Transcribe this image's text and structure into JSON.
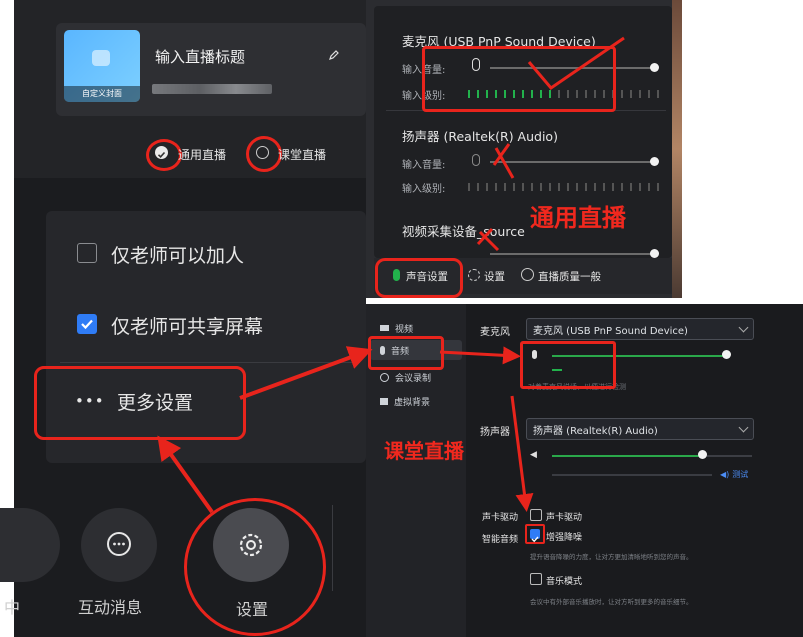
{
  "broadcast_card": {
    "cover_label": "自定义封面",
    "title_placeholder": "输入直播标题",
    "mode_general": "通用直播",
    "mode_class": "课堂直播"
  },
  "settings_menu": {
    "only_teacher_add": "仅老师可以加人",
    "only_teacher_share": "仅老师可共享屏幕",
    "more_settings": "更多设置"
  },
  "bottom_bar": {
    "partial_left": "中",
    "interactive_messages": "互动消息",
    "settings": "设置"
  },
  "audio_panel_general": {
    "mic_title": "麦克风 (USB PnP Sound Device)",
    "input_volume": "输入音量:",
    "input_level": "输入级别:",
    "speaker_title": "扬声器 (Realtek(R) Audio)",
    "video_source": "视频采集设备_source",
    "tab_audio": "声音设置",
    "tab_settings": "设置",
    "tab_quality": "直播质量一般"
  },
  "annotation": {
    "general_live": "通用直播",
    "class_live": "课堂直播"
  },
  "class_settings": {
    "nav": [
      "视频",
      "音频",
      "会议录制",
      "虚拟背景"
    ],
    "mic_label": "麦克风",
    "mic_device": "麦克风 (USB PnP Sound Device)",
    "mic_hint": "对着麦克风说话，以便进行检测",
    "speaker_label": "扬声器",
    "speaker_device": "扬声器 (Realtek(R) Audio)",
    "test_label": "测试",
    "sound_driver_label": "声卡驱动",
    "sound_driver_option": "声卡驱动",
    "smart_audio_label": "智能音频",
    "noise_option": "增强降噪",
    "noise_desc": "提升语音降噪的力度，让对方更加清晰地听到您的声音。",
    "music_option": "音乐模式",
    "music_desc": "会议中有外部音乐播放时，让对方听到更多的音乐细节。"
  },
  "colors": {
    "accent_red": "#e8241c",
    "level_green": "#22b24c",
    "checkbox_blue": "#2f7cf6"
  }
}
